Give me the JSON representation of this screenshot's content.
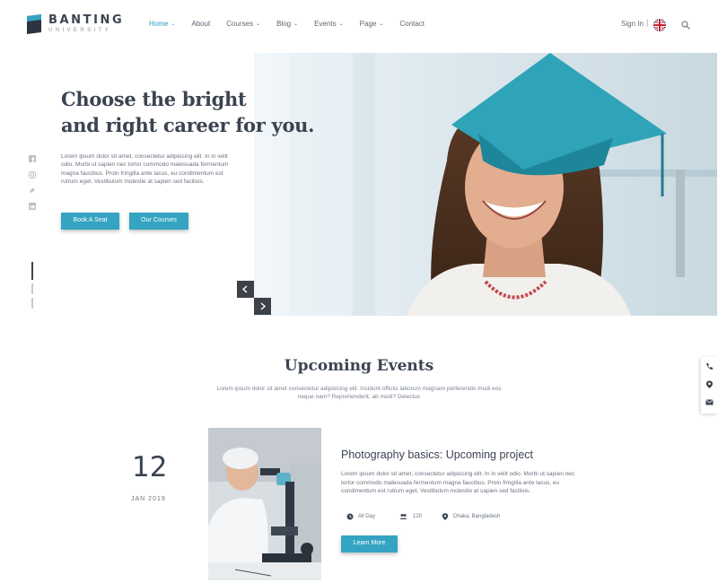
{
  "brand": {
    "name": "BANTING",
    "sub": "UNIVERSITY"
  },
  "nav": [
    {
      "label": "Home",
      "caret": true,
      "active": true
    },
    {
      "label": "About",
      "caret": false
    },
    {
      "label": "Courses",
      "caret": true
    },
    {
      "label": "Blog",
      "caret": true
    },
    {
      "label": "Events",
      "caret": true
    },
    {
      "label": "Page",
      "caret": true
    },
    {
      "label": "Contact",
      "caret": false
    }
  ],
  "header": {
    "signin": "Sign In",
    "separator": "|"
  },
  "hero": {
    "title_line1": "Choose the bright",
    "title_line2": "and right career for you.",
    "description": "Lorem ipsum dolor sit amet, consectetur adipiscing elit. In in velit odio. Morbi ut sapien nec tortor commodo malesuada fermentum magna faucibus. Proin fringilla ante lacus, eu condimentum est rutrum eget. Vestibulum molestie at sapien sed facilisis.",
    "book_button": "Book A Seat",
    "courses_button": "Our Courses"
  },
  "slider": {
    "prev_icon": "chevron-left-icon",
    "next_icon": "chevron-right-icon"
  },
  "events": {
    "title": "Upcoming Events",
    "subtitle": "Lorem ipsum dolor sit amet consectetur adipisicing elit. Incidunt officiis laborum magnam perferendis modi eos neque nam? Reprehenderit, ab modi? Delectus",
    "item": {
      "day": "12",
      "month": "JAN 2019",
      "title": "Photography basics: Upcoming project",
      "description": "Lorem ipsum dolor sit amet, consectetur adipiscing elit. In in velit odio. Morbi ut sapien nec tortor commodo malesuada fermentum magna faucibus. Proin fringilla ante lacus, eu condimentum est rutrum eget. Vestibulum molestie at sapien sed facilisis.",
      "time": "All Day",
      "attendees": "120",
      "location": "Dhaka, Bangladesh",
      "button": "Learn More"
    }
  },
  "colors": {
    "accent": "#35a4c2",
    "text": "#3b4451",
    "dark_button": "#3d4249"
  }
}
